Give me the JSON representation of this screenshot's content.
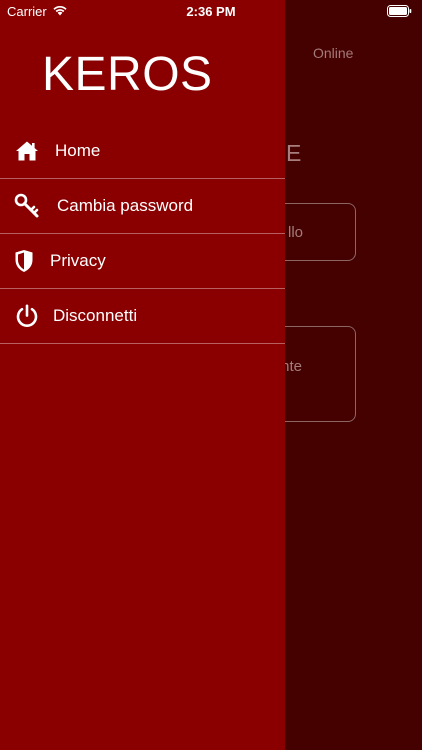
{
  "status_bar": {
    "carrier": "Carrier",
    "time": "2:36 PM"
  },
  "main": {
    "online": "Online",
    "heading": "E",
    "button_1": "llo",
    "button_2": "nte"
  },
  "drawer": {
    "title": "KEROS",
    "items": [
      {
        "label": "Home",
        "icon": "home-icon"
      },
      {
        "label": "Cambia password",
        "icon": "key-icon"
      },
      {
        "label": "Privacy",
        "icon": "shield-icon"
      },
      {
        "label": "Disconnetti",
        "icon": "power-icon"
      }
    ]
  },
  "colors": {
    "drawer_bg": "#8a0000",
    "overlay_bg": "#450000",
    "text": "#ffffff"
  }
}
